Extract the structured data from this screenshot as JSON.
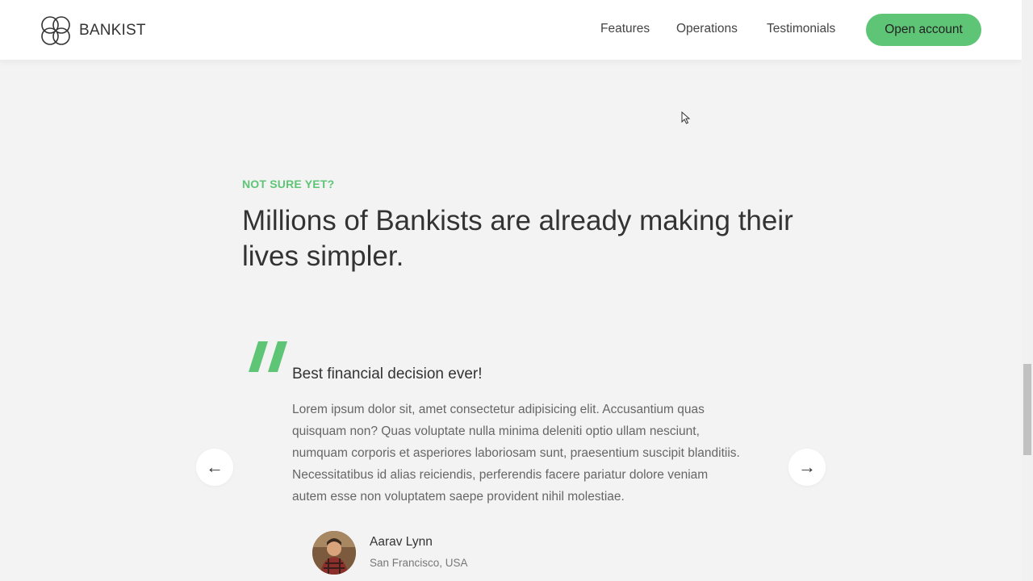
{
  "header": {
    "brand": "BANKIST",
    "logo_icon": "bankist-logo-icon",
    "nav": [
      {
        "label": "Features"
      },
      {
        "label": "Operations"
      },
      {
        "label": "Testimonials"
      }
    ],
    "cta_label": "Open account"
  },
  "section": {
    "eyebrow": "NOT SURE YET?",
    "headline": "Millions of Bankists are already making their lives simpler."
  },
  "testimonial": {
    "quote_icon": "quote-mark-icon",
    "title": "Best financial decision ever!",
    "body": "Lorem ipsum dolor sit, amet consectetur adipisicing elit. Accusantium quas quisquam non? Quas voluptate nulla minima deleniti optio ullam nesciunt, numquam corporis et asperiores laboriosam sunt, praesentium suscipit blanditiis. Necessitatibus id alias reiciendis, perferendis facere pariatur dolore veniam autem esse non voluptatem saepe provident nihil molestiae.",
    "author_name": "Aarav Lynn",
    "author_location": "San Francisco, USA",
    "prev_icon": "arrow-left",
    "next_icon": "arrow-right",
    "prev_glyph": "←",
    "next_glyph": "→"
  },
  "colors": {
    "accent": "#5ec576",
    "background": "#f3f3f3",
    "header_bg": "#ffffff",
    "text": "#444444"
  }
}
